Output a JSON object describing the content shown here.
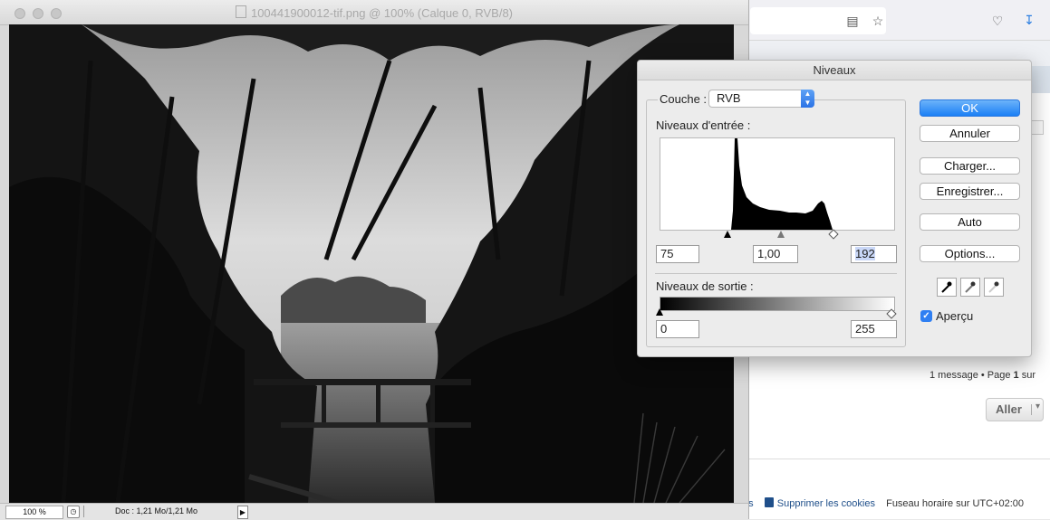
{
  "photoshop": {
    "window_title": "100441900012-tif.png @ 100% (Calque 0, RVB/8)",
    "status": {
      "zoom": "100 %",
      "doc_size": "Doc : 1,21 Mo/1,21 Mo"
    }
  },
  "levels": {
    "title": "Niveaux",
    "channel_label": "Couche :",
    "channel_value": "RVB",
    "input_label": "Niveaux d'entrée :",
    "input_black": "75",
    "input_gamma": "1,00",
    "input_white": "192",
    "output_label": "Niveaux de sortie :",
    "output_black": "0",
    "output_white": "255",
    "preview_label": "Aperçu",
    "preview_checked": true,
    "buttons": {
      "ok": "OK",
      "cancel": "Annuler",
      "load": "Charger...",
      "save": "Enregistrer...",
      "auto": "Auto",
      "options": "Options..."
    }
  },
  "browser": {
    "pagination_prefix": "1 message • Page ",
    "pagination_page": "1",
    "pagination_suffix": " sur",
    "goto_button": "Aller",
    "footer_partial": "es",
    "delete_cookies": "Supprimer les cookies",
    "timezone": "Fuseau horaire sur UTC+02:00"
  }
}
